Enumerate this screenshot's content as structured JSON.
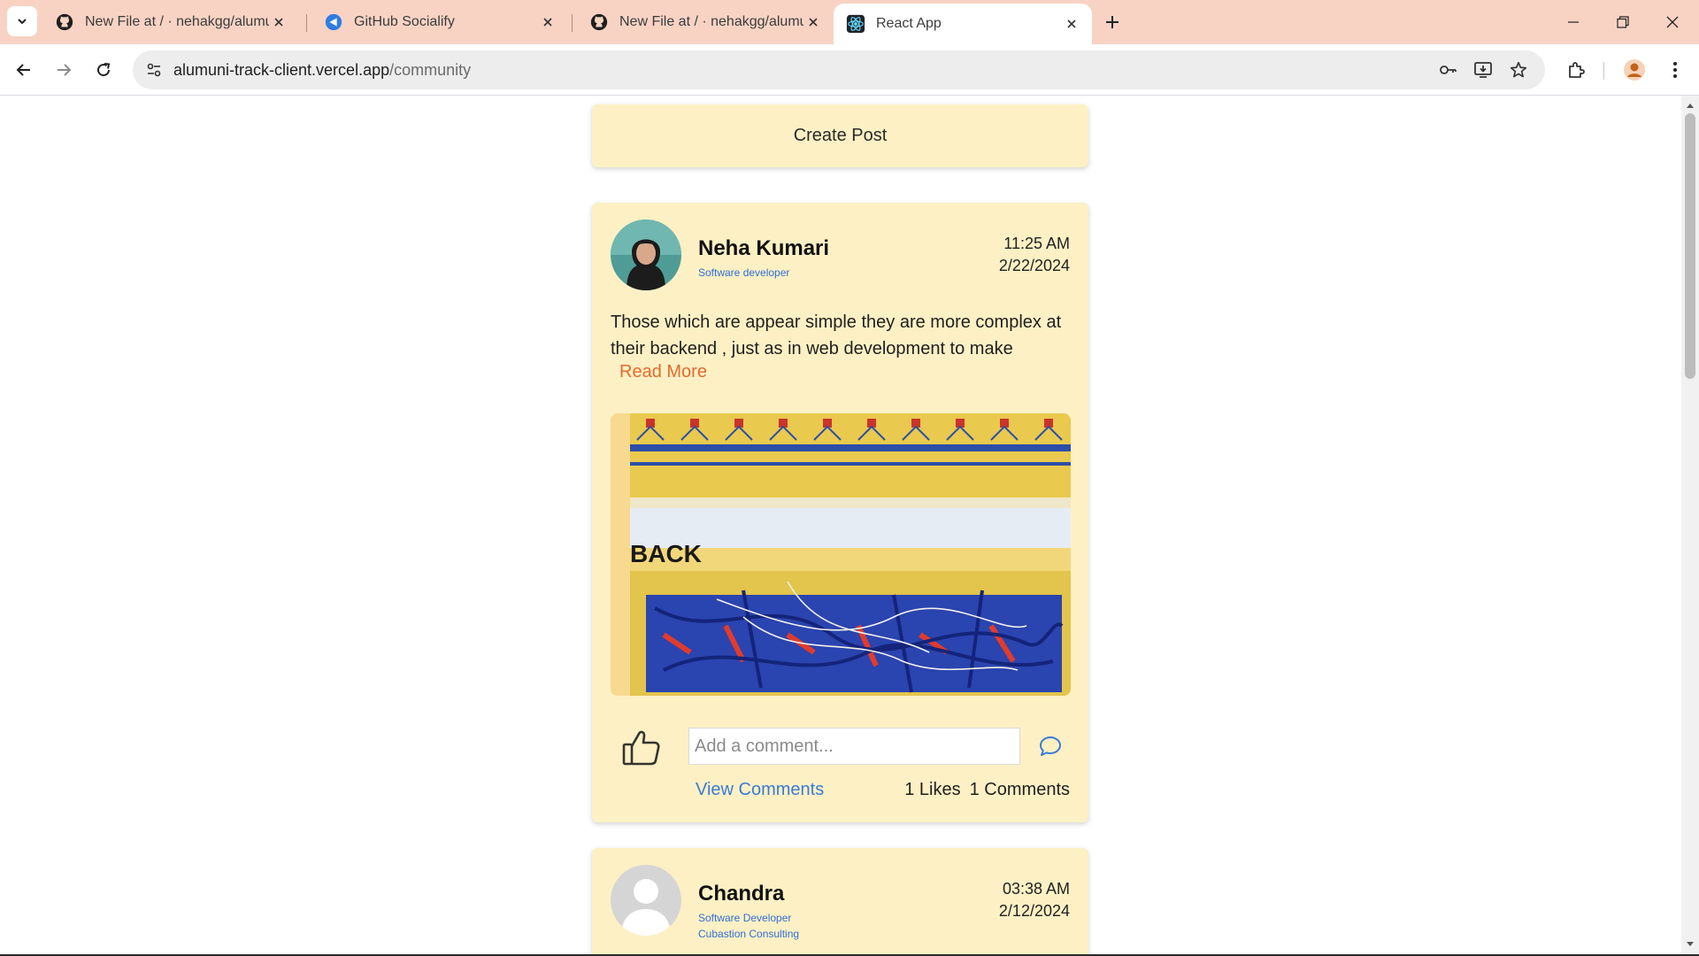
{
  "browser": {
    "tabs": [
      {
        "title": "New File at / · nehakgg/alumuni-track-client",
        "icon": "github-icon"
      },
      {
        "title": "GitHub Socialify",
        "icon": "socialify-icon"
      },
      {
        "title": "New File at / · nehakgg/alumuni-track-client",
        "icon": "github-icon"
      },
      {
        "title": "React App",
        "icon": "react-icon"
      }
    ],
    "url_host": "alumuni-track-client.vercel.app",
    "url_path": "/community"
  },
  "page": {
    "create_post_label": "Create Post",
    "posts": [
      {
        "author": "Neha Kumari",
        "title": "Software developer",
        "time": "11:25 AM",
        "date": "2/22/2024",
        "text": "Those which are appear simple they are more complex at their backend , just as in web development to make",
        "read_more": "Read More",
        "image_text": "BACK",
        "comment_placeholder": "Add a comment...",
        "view_comments": "View Comments",
        "likes": "1 Likes",
        "comments": "1 Comments"
      },
      {
        "author": "Chandra",
        "title": "Software Developer",
        "company": "Cubastion Consulting",
        "time": "03:38 AM",
        "date": "2/12/2024"
      }
    ]
  },
  "colors": {
    "card_bg": "#fdf0c4",
    "tabbar_bg": "#f8d3c4",
    "read_more": "#e46a2e",
    "link_blue": "#3a7bd5",
    "subtitle_blue": "#2f6fd6"
  }
}
